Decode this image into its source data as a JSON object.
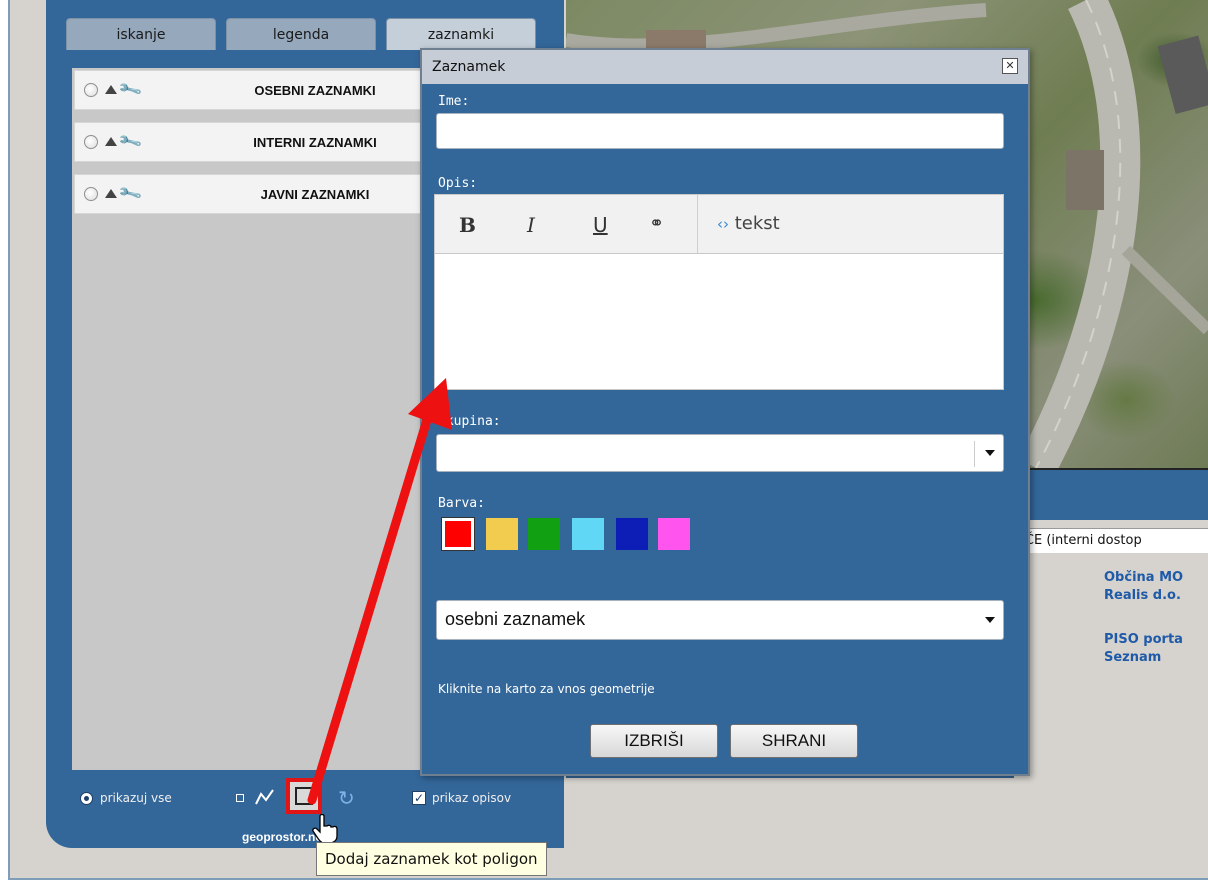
{
  "tabs": [
    {
      "label": "iskanje"
    },
    {
      "label": "legenda"
    },
    {
      "label": "zaznamki"
    }
  ],
  "layers": [
    {
      "label": "OSEBNI ZAZNAMKI"
    },
    {
      "label": "INTERNI ZAZNAMKI"
    },
    {
      "label": "JAVNI ZAZNAMKI"
    }
  ],
  "bottom_bar": {
    "show_all_label": "prikazuj vse",
    "show_descriptions_label": "prikaz opisov",
    "show_descriptions_checked": true,
    "logo_text": "geoprostor.net"
  },
  "tooltip": {
    "text": "Dodaj zaznamek kot poligon"
  },
  "info_panel": {
    "header": "VČE (interni dostop",
    "links": [
      "Občina MO",
      "Realis d.o.",
      "PISO porta",
      "Seznam"
    ]
  },
  "dialog": {
    "title": "Zaznamek",
    "name_label": "Ime:",
    "name_value": "",
    "description_label": "Opis:",
    "toolbar": {
      "bold": "B",
      "italic": "I",
      "underline": "U",
      "link_icon": "link-icon",
      "source_label": "tekst"
    },
    "group_label": "Skupina:",
    "group_value": "",
    "color_label": "Barva:",
    "colors": [
      "#ff0000",
      "#f2cc4f",
      "#11a011",
      "#5fd7f5",
      "#0d1eb6",
      "#ff55ee"
    ],
    "selected_color": "#ff0000",
    "type_value": "osebni zaznamek",
    "hint": "Kliknite na karto za vnos geometrije",
    "delete_label": "IZBRIŠI",
    "save_label": "SHRANI"
  },
  "colors": {
    "panel_blue": "#336699",
    "annotation_red": "#ee1111"
  }
}
